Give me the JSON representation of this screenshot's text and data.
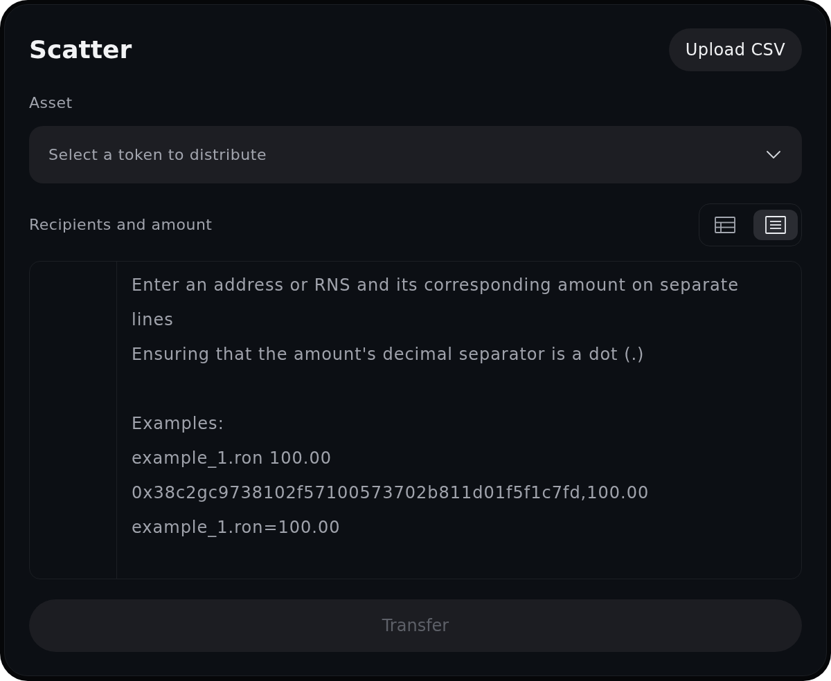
{
  "title": "Scatter",
  "upload_button": {
    "label": "Upload CSV"
  },
  "asset": {
    "label": "Asset",
    "select": {
      "placeholder": "Select a token to distribute"
    }
  },
  "recipients": {
    "label": "Recipients and amount",
    "views": [
      {
        "kind": "table",
        "selected": false
      },
      {
        "kind": "text",
        "selected": true
      }
    ],
    "input": {
      "placeholder": "Enter an address or RNS and its corresponding amount on separate lines\nEnsuring that the amount's decimal separator is a dot (.)\n\nExamples:\nexample_1.ron 100.00\n0x38c2gc9738102f57100573702b811d01f5f1c7fd,100.00\nexample_1.ron=100.00"
    }
  },
  "transfer_button": {
    "label": "Transfer",
    "disabled": true
  }
}
